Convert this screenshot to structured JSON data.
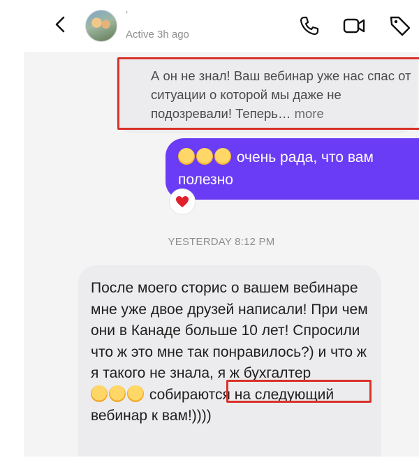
{
  "header": {
    "contact_name": "'",
    "status": "Active 3h ago"
  },
  "messages": {
    "incoming1": {
      "text": "А он не знал! Ваш вебинар уже нас спас от ситуации о которой мы даже не подозревали! Теперь…",
      "more": "more"
    },
    "outgoing1": {
      "text": "очень рада, что вам полезно",
      "emojis": [
        "smiling-face-with-open-hands",
        "smiling-face-with-open-hands",
        "smiling-face-with-open-hands"
      ],
      "reaction": "red-heart"
    },
    "timestamp": "YESTERDAY 8:12 PM",
    "incoming2": {
      "text_part1": "После моего сторис о вашем вебинаре мне уже двое друзей написали! При чем они в Канаде больше 10 лет! Спросили что ж это мне так понравилось?) и что ж я такого не знала, я ж бухгалтер",
      "emojis": [
        "rolling-on-the-floor-laughing",
        "rolling-on-the-floor-laughing",
        "rolling-on-the-floor-laughing"
      ],
      "text_part2": "собираются на следующий вебинар к вам!))))"
    }
  },
  "colors": {
    "outgoing_bubble": "#6b3cf5",
    "incoming_bubble": "#ececee",
    "highlight_box": "#d8322a"
  }
}
